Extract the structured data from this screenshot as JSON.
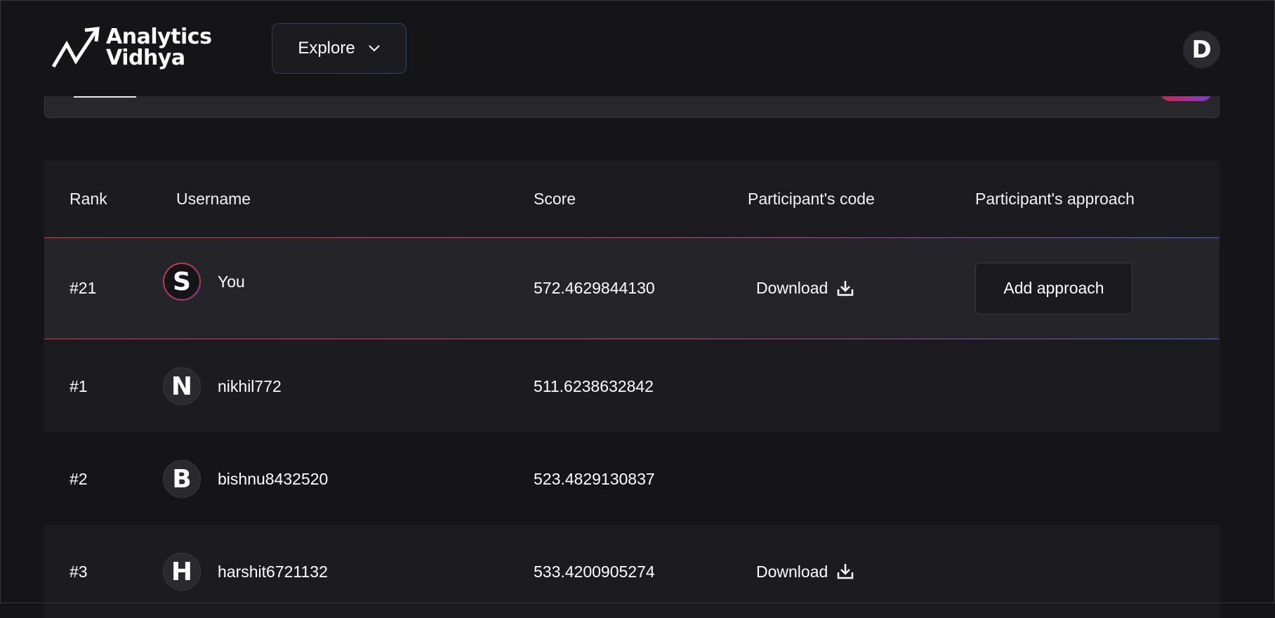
{
  "header": {
    "logo_line1": "Analytics",
    "logo_line2": "Vidhya",
    "explore_label": "Explore",
    "profile_initial": "D"
  },
  "table": {
    "columns": {
      "rank": "Rank",
      "username": "Username",
      "score": "Score",
      "code": "Participant's code",
      "approach": "Participant's approach"
    },
    "current_user_row": {
      "rank": "#21",
      "initial": "S",
      "username": "You",
      "score": "572.4629844130",
      "download_label": "Download",
      "approach_button": "Add approach"
    },
    "rows": [
      {
        "rank": "#1",
        "initial": "N",
        "username": "nikhil772",
        "score": "511.6238632842"
      },
      {
        "rank": "#2",
        "initial": "B",
        "username": "bishnu8432520",
        "score": "523.4829130837"
      },
      {
        "rank": "#3",
        "initial": "H",
        "username": "harshit6721132",
        "score": "533.4200905274",
        "download_label": "Download"
      }
    ]
  },
  "colors": {
    "background": "#151417",
    "row_alt": "#1c1b1f",
    "highlight_row": "#252428",
    "accent_red": "#d23a3a",
    "accent_blue": "#4a5bd6"
  }
}
